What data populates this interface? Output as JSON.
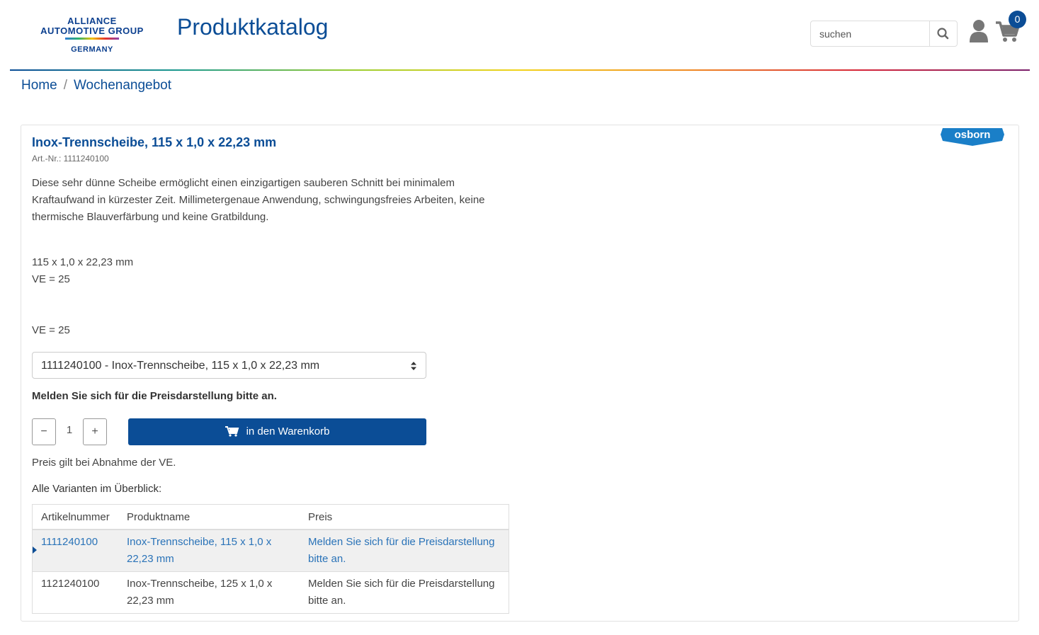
{
  "header": {
    "logo_line1": "ALLIANCE",
    "logo_line2": "AUTOMOTIVE GROUP",
    "logo_line3": "GERMANY",
    "title": "Produktkatalog",
    "search_placeholder": "suchen",
    "cart_count": "0"
  },
  "breadcrumb": {
    "home": "Home",
    "separator": "/",
    "current": "Wochenangebot"
  },
  "product": {
    "brand": "osborn",
    "title": "Inox-Trennscheibe, 115 x 1,0 x 22,23 mm",
    "article_number": "Art.-Nr.: 1111240100",
    "description": "Diese sehr dünne Scheibe ermöglicht einen einzigartigen sauberen Schnitt bei minimalem Kraftaufwand in kürzester Zeit. Millimetergenaue Anwendung, schwingungsfreies Arbeiten, keine thermische Blauverfärbung und keine Gratbildung.",
    "dimensions": "115 x 1,0 x 22,23 mm",
    "ve_1": "VE = 25",
    "ve_2": "VE = 25",
    "variant_selected": "1111240100 - Inox-Trennscheibe, 115 x 1,0 x 22,23 mm",
    "login_note": "Melden Sie sich für die Preisdarstellung bitte an.",
    "quantity": "1",
    "minus_label": "−",
    "plus_label": "+",
    "add_to_cart": "in den Warenkorb",
    "price_note": "Preis gilt bei Abnahme der VE.",
    "variants_label": "Alle Varianten im Überblick:"
  },
  "variants_table": {
    "headers": [
      "Artikelnummer",
      "Produktname",
      "Preis"
    ],
    "rows": [
      [
        "1111240100",
        "Inox-Trennscheibe, 115 x 1,0 x 22,23 mm",
        "Melden Sie sich für die Preisdarstellung bitte an."
      ],
      [
        "1121240100",
        "Inox-Trennscheibe, 125 x 1,0 x 22,23 mm",
        "Melden Sie sich für die Preisdarstellung bitte an."
      ]
    ]
  },
  "colors": {
    "brand_blue": "#0b4d96",
    "link_blue": "#2a73b8",
    "osborn_blue": "#1a7fc8"
  }
}
